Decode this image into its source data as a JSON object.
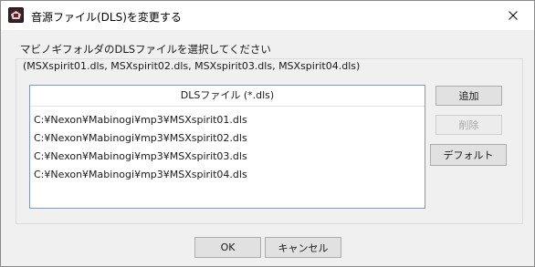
{
  "window": {
    "title": "音源ファイル(DLS)を変更する",
    "icon": "mabinogi-app-icon"
  },
  "titlebar": {
    "close_icon": "close-icon"
  },
  "instruction": "マビノギフォルダのDLSファイルを選択してください",
  "group": {
    "legend": "(MSXspirit01.dls, MSXspirit02.dls, MSXspirit03.dls, MSXspirit04.dls)"
  },
  "file_list": {
    "header": "DLSファイル (*.dls)",
    "items": [
      "C:¥Nexon¥Mabinogi¥mp3¥MSXspirit01.dls",
      "C:¥Nexon¥Mabinogi¥mp3¥MSXspirit02.dls",
      "C:¥Nexon¥Mabinogi¥mp3¥MSXspirit03.dls",
      "C:¥Nexon¥Mabinogi¥mp3¥MSXspirit04.dls"
    ]
  },
  "buttons": {
    "add": "追加",
    "delete": "削除",
    "default": "デフォルト",
    "ok": "OK",
    "cancel": "キャンセル"
  }
}
